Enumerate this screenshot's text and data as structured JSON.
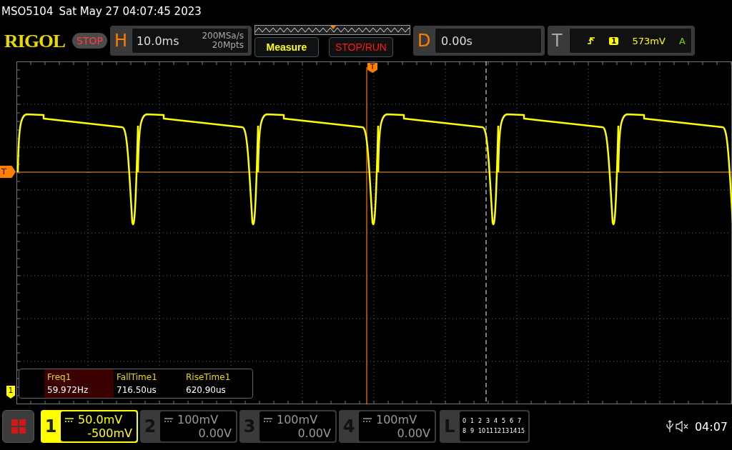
{
  "status_line": {
    "model": "MSO5104",
    "datetime": "Sat May 27 04:07:45 2023"
  },
  "header": {
    "logo": "RIGOL",
    "run_state": "STOP",
    "horizontal": {
      "label": "H",
      "timebase": "10.0ms",
      "sample_rate": "200MSa/s",
      "memory_depth": "20Mpts"
    },
    "buttons": [
      {
        "label": "Measure",
        "kind": "measure"
      },
      {
        "label": "STOP/RUN",
        "kind": "stoprun"
      }
    ],
    "delay": {
      "label": "D",
      "value": "0.00s"
    },
    "trigger": {
      "label": "T",
      "source": "1",
      "level": "573mV",
      "mode": "A"
    }
  },
  "graticule": {
    "time_marker": "T",
    "trigger_marker": "T",
    "channel_marker": "1"
  },
  "measurements": [
    {
      "name": "Freq1",
      "value": "59.972Hz",
      "selected": true
    },
    {
      "name": "FallTime1",
      "value": "716.50us",
      "selected": false
    },
    {
      "name": "RiseTime1",
      "value": "620.90us",
      "selected": false
    }
  ],
  "channels": [
    {
      "number": "1",
      "scale": "50.0mV",
      "offset": "-500mV",
      "on": true
    },
    {
      "number": "2",
      "scale": "100mV",
      "offset": "0.00V",
      "on": false
    },
    {
      "number": "3",
      "scale": "100mV",
      "offset": "0.00V",
      "on": false
    },
    {
      "number": "4",
      "scale": "100mV",
      "offset": "0.00V",
      "on": false
    }
  ],
  "logic": {
    "label": "L",
    "rows": [
      [
        "0",
        "1",
        "2",
        "3",
        "4",
        "5",
        "6",
        "7"
      ],
      [
        "8",
        "9",
        "10",
        "11",
        "12",
        "13",
        "14",
        "15"
      ]
    ]
  },
  "clock": "04:07"
}
